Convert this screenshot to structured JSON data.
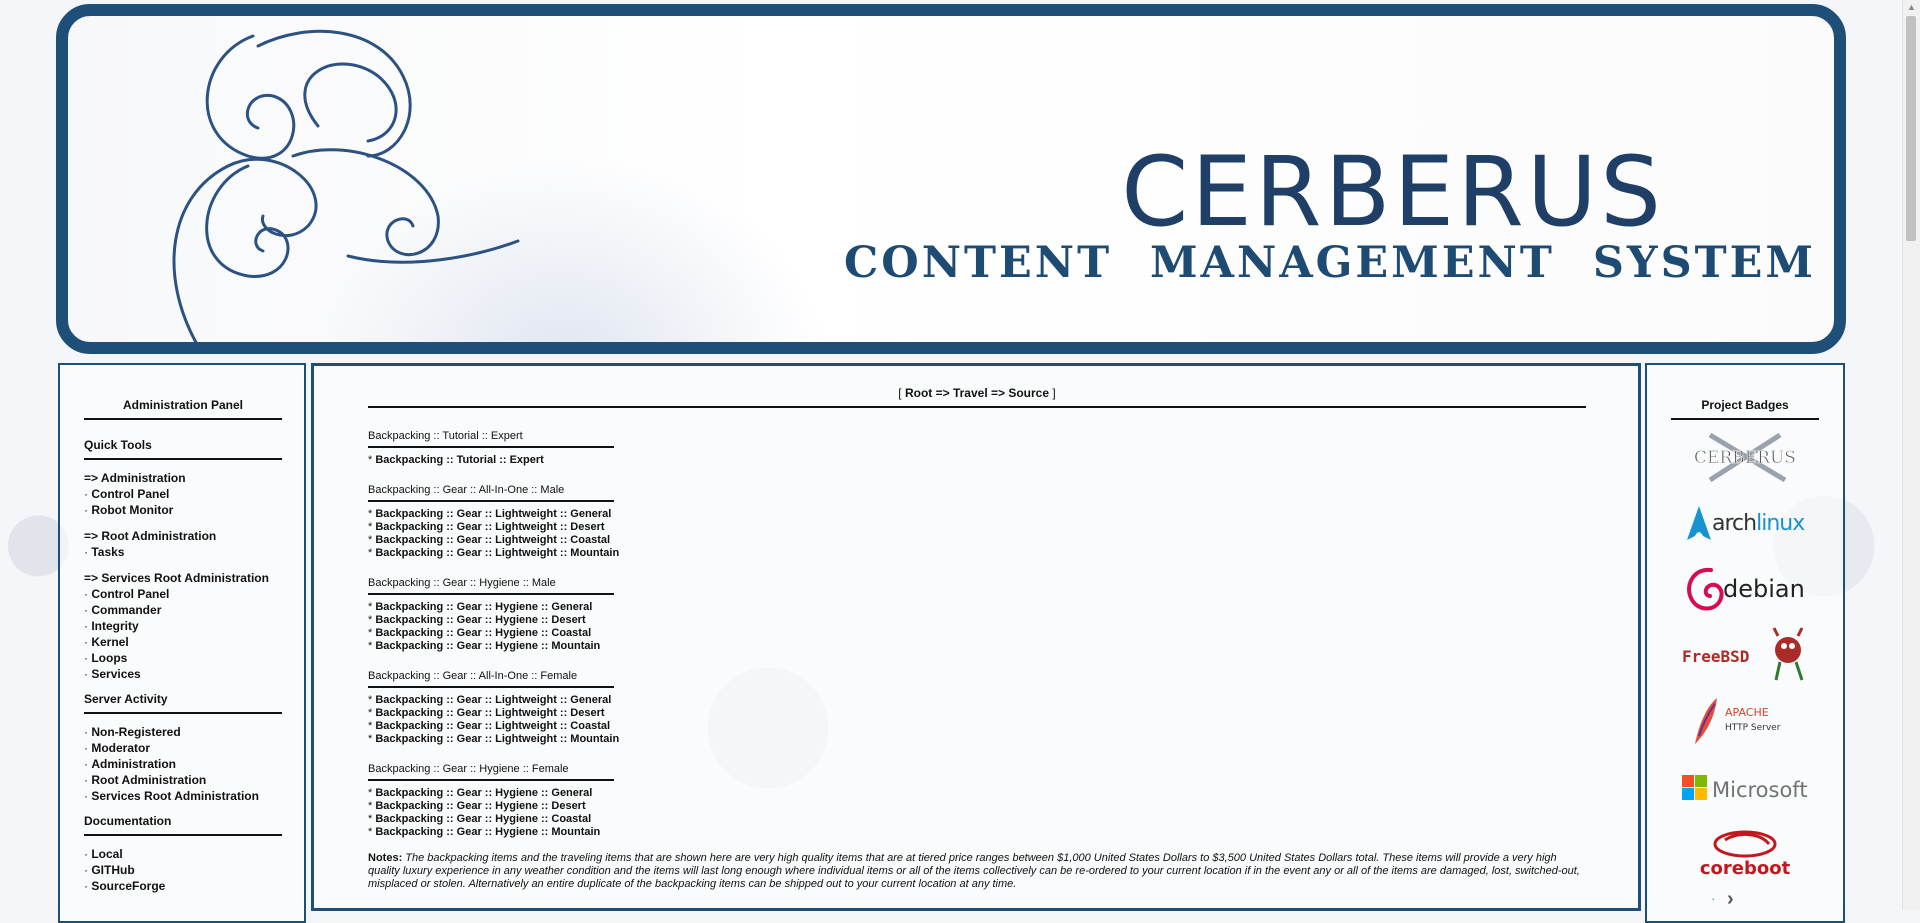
{
  "banner": {
    "title": "CERBERUS",
    "subtitle": "CONTENT MANAGEMENT SYSTEM"
  },
  "sidebar": {
    "heading": "Administration Panel",
    "quick_tools": {
      "heading": "Quick Tools",
      "groups": [
        {
          "title": "=> Administration",
          "items": [
            "Control Panel",
            "Robot Monitor"
          ]
        },
        {
          "title": "=> Root Administration",
          "items": [
            "Tasks"
          ]
        },
        {
          "title": "=> Services Root Administration",
          "items": [
            "Control Panel",
            "Commander",
            "Integrity",
            "Kernel",
            "Loops",
            "Services"
          ]
        }
      ]
    },
    "server_activity": {
      "heading": "Server Activity",
      "items": [
        "Non-Registered",
        "Moderator",
        "Administration",
        "Root Administration",
        "Services Root Administration"
      ]
    },
    "documentation": {
      "heading": "Documentation",
      "items": [
        "Local",
        "GITHub",
        "SourceForge"
      ]
    }
  },
  "main": {
    "breadcrumb": "Root => Travel => Source",
    "sections": [
      {
        "heading": "Backpacking :: Tutorial :: Expert",
        "links": [
          "Backpacking :: Tutorial :: Expert"
        ]
      },
      {
        "heading": "Backpacking :: Gear :: All-In-One :: Male",
        "links": [
          "Backpacking :: Gear :: Lightweight :: General",
          "Backpacking :: Gear :: Lightweight :: Desert",
          "Backpacking :: Gear :: Lightweight :: Coastal",
          "Backpacking :: Gear :: Lightweight :: Mountain"
        ]
      },
      {
        "heading": "Backpacking :: Gear :: Hygiene :: Male",
        "links": [
          "Backpacking :: Gear :: Hygiene :: General",
          "Backpacking :: Gear :: Hygiene :: Desert",
          "Backpacking :: Gear :: Hygiene :: Coastal",
          "Backpacking :: Gear :: Hygiene :: Mountain"
        ]
      },
      {
        "heading": "Backpacking :: Gear :: All-In-One :: Female",
        "links": [
          "Backpacking :: Gear :: Lightweight :: General",
          "Backpacking :: Gear :: Lightweight :: Desert",
          "Backpacking :: Gear :: Lightweight :: Coastal",
          "Backpacking :: Gear :: Lightweight :: Mountain"
        ]
      },
      {
        "heading": "Backpacking :: Gear :: Hygiene :: Female",
        "links": [
          "Backpacking :: Gear :: Hygiene :: General",
          "Backpacking :: Gear :: Hygiene :: Desert",
          "Backpacking :: Gear :: Hygiene :: Coastal",
          "Backpacking :: Gear :: Hygiene :: Mountain"
        ]
      }
    ],
    "notes_label": "Notes",
    "notes_text": "The backpacking items and the traveling items that are shown here are very high quality items that are at tiered price ranges between $1,000 United States Dollars to $3,500 United States Dollars total. These items will provide a very high quality luxury experience in any weather condition and the items will last long enough where individual items or all of the items collectively can be re-ordered to your current location if in the event any or all of the items are damaged, lost, switched-out, misplaced or stolen. Alternatively an entire duplicate of the backpacking items can be shipped out to your current location at any time."
  },
  "badges": {
    "heading": "Project Badges",
    "items": [
      {
        "name": "cerberus",
        "text": "CERBERUS"
      },
      {
        "name": "archlinux",
        "text_a": "arch",
        "text_b": "linux"
      },
      {
        "name": "debian",
        "text": "debian"
      },
      {
        "name": "freebsd",
        "text": "FreeBSD"
      },
      {
        "name": "apache",
        "text_a": "APACHE",
        "text_b": "HTTP Server"
      },
      {
        "name": "microsoft",
        "text": "Microsoft"
      },
      {
        "name": "coreboot",
        "text": "coreboot"
      }
    ]
  },
  "colors": {
    "frame": "#1e4f78",
    "title": "#1f3f66",
    "arch_blue": "#1793d1",
    "debian_red": "#d70a53",
    "freebsd_red": "#ab2b28",
    "coreboot_red": "#c4161c"
  }
}
